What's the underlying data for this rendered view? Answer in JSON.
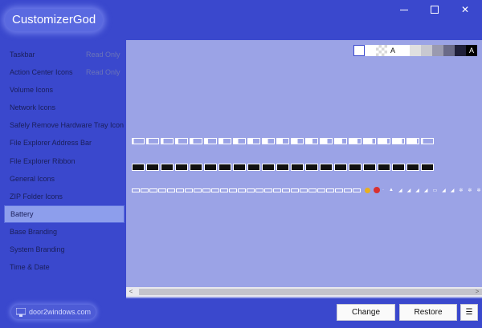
{
  "app": {
    "title": "CustomizerGod"
  },
  "window_controls": {
    "minimize": "minimize-icon",
    "maximize": "maximize-icon",
    "close": "close-icon",
    "close_glyph": "✕"
  },
  "sidebar": {
    "items": [
      {
        "label": "Taskbar",
        "tag": "Read Only"
      },
      {
        "label": "Action Center Icons",
        "tag": "Read Only"
      },
      {
        "label": "Volume Icons",
        "tag": ""
      },
      {
        "label": "Network Icons",
        "tag": ""
      },
      {
        "label": "Safely Remove Hardware Tray Icon",
        "tag": ""
      },
      {
        "label": "File Explorer Address Bar",
        "tag": ""
      },
      {
        "label": "File Explorer Ribbon",
        "tag": ""
      },
      {
        "label": "General Icons",
        "tag": ""
      },
      {
        "label": "ZIP Folder Icons",
        "tag": ""
      },
      {
        "label": "Battery",
        "tag": "",
        "selected": true
      },
      {
        "label": "Base Branding",
        "tag": ""
      },
      {
        "label": "System Branding",
        "tag": ""
      },
      {
        "label": "Time & Date",
        "tag": ""
      }
    ]
  },
  "swatches": {
    "colors": [
      "#ffffff",
      "#ffffff",
      "checker",
      "#ffffff",
      "#ffffff",
      "#e0e0e0",
      "#c8c8d0",
      "#9a9ab0",
      "#6a6a88",
      "#20203a",
      "#000000"
    ],
    "letter_labels": [
      "A",
      "A"
    ]
  },
  "strips": {
    "white_outline_count": 21,
    "black_filled_count": 21,
    "small_icon_count": 26,
    "tray_glyphs": [
      "·",
      "▲",
      "◢",
      "◢",
      "◢",
      "◢",
      "▭",
      "◢",
      "◢",
      "✲",
      "✲",
      "✲",
      "✲"
    ]
  },
  "scroll": {
    "left_arrow": "<",
    "right_arrow": ">"
  },
  "footer": {
    "logo_text": "door2windows.com",
    "change_label": "Change",
    "restore_label": "Restore",
    "menu_glyph": "☰"
  }
}
